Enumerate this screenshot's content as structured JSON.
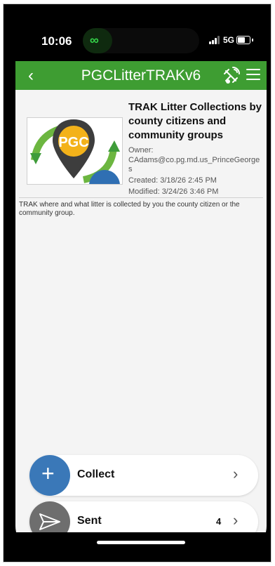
{
  "status": {
    "time": "10:06",
    "network": "5G"
  },
  "appbar": {
    "title": "PGCLitterTRAKv6"
  },
  "survey": {
    "logo_text": "PGC",
    "title": "TRAK Litter Collections by county citizens and community groups",
    "owner_label": "Owner:",
    "owner_value": "CAdams@co.pg.md.us_PrinceGeorges",
    "created": "Created: 3/18/26 2:45 PM",
    "modified": "Modified: 3/24/26 3:46 PM",
    "description": "TRAK where and what litter is collected by you the county citizen or the community group."
  },
  "actions": {
    "collect": {
      "label": "Collect",
      "color": "#3a78b8"
    },
    "sent": {
      "label": "Sent",
      "count": "4",
      "color": "#6e6e6e"
    }
  },
  "colors": {
    "appbar": "#3e9d32",
    "accent_green": "#35d44a"
  }
}
